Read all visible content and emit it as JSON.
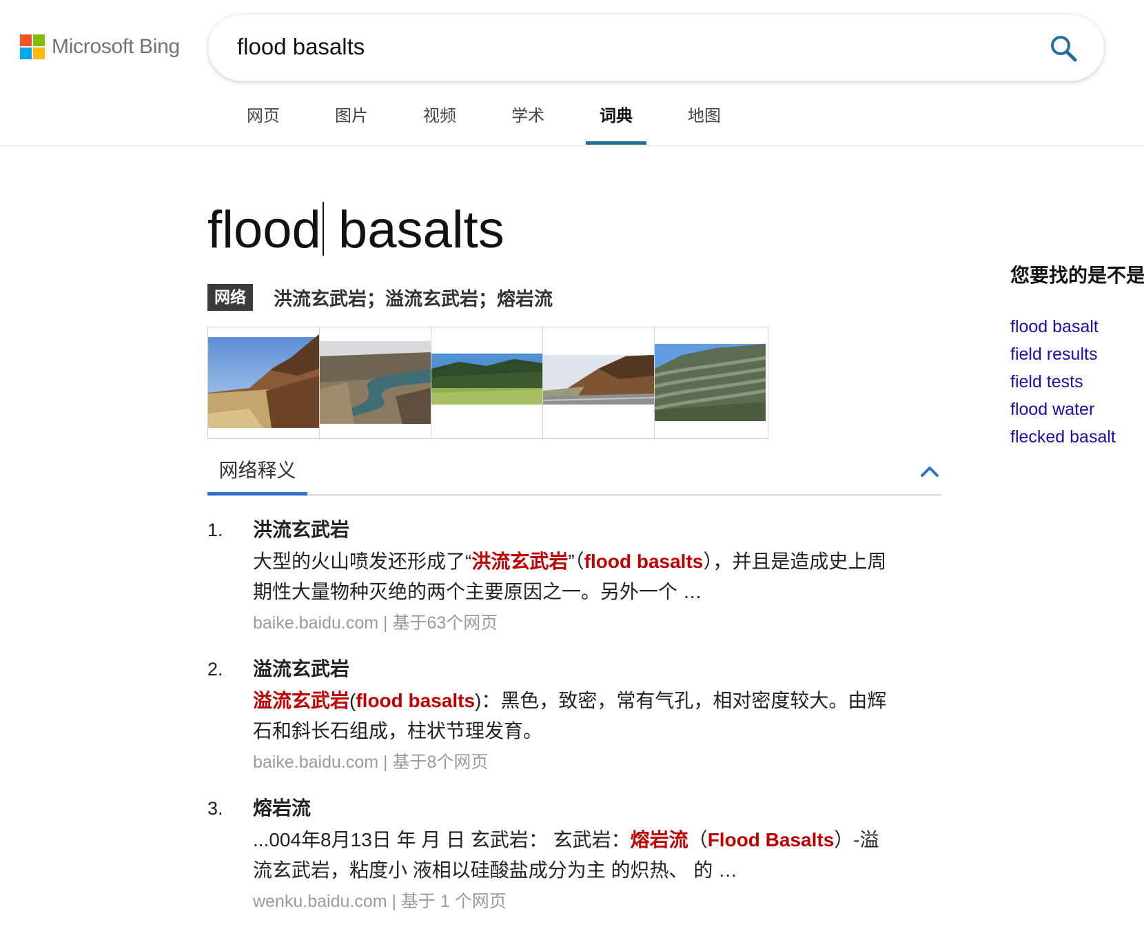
{
  "brand": {
    "name": "Microsoft Bing",
    "logo_colors": [
      "#f35325",
      "#81bc06",
      "#05a6f0",
      "#ffba08"
    ]
  },
  "search": {
    "query": "flood basalts",
    "button_icon": "search-icon"
  },
  "nav": {
    "tabs": [
      {
        "label": "网页"
      },
      {
        "label": "图片"
      },
      {
        "label": "视频"
      },
      {
        "label": "学术"
      },
      {
        "label": "词典",
        "active": true
      },
      {
        "label": "地图"
      }
    ],
    "accent_color": "#1f7399"
  },
  "dictionary": {
    "word": "flood basalts",
    "net_badge": "网络",
    "net_definitions": "洪流玄武岩；溢流玄武岩；熔岩流",
    "images": [
      {
        "name": "image-cliff-desert"
      },
      {
        "name": "image-river-canyon"
      },
      {
        "name": "image-forested-valley"
      },
      {
        "name": "image-roadside-outcrop"
      },
      {
        "name": "image-layered-hills"
      }
    ],
    "section_tab": "网络释义",
    "collapse_icon": "chevron-up-icon",
    "highlight_color": "#c00000",
    "entries": [
      {
        "num": "1.",
        "heading": "洪流玄武岩",
        "body": [
          {
            "t": "大型的火山喷发还形成了“"
          },
          {
            "t": "洪流玄武岩",
            "hl": true
          },
          {
            "t": "”（"
          },
          {
            "t": "flood basalts",
            "hl": true
          },
          {
            "t": "），并且是造成史上周期性大量物种灭绝的两个主要原因之一。另外一个 …"
          }
        ],
        "source": "baike.baidu.com | 基于63个网页"
      },
      {
        "num": "2.",
        "heading": "溢流玄武岩",
        "body": [
          {
            "t": "溢流玄武岩",
            "hl": true
          },
          {
            "t": "("
          },
          {
            "t": "flood basalts",
            "hl": true
          },
          {
            "t": ")：黑色，致密，常有气孔，相对密度较大。由辉石和斜长石组成，柱状节理发育。"
          }
        ],
        "source": "baike.baidu.com | 基于8个网页"
      },
      {
        "num": "3.",
        "heading": "熔岩流",
        "body": [
          {
            "t": "...004年8月13日 年 月 日 玄武岩： 玄武岩："
          },
          {
            "t": "熔岩流",
            "hl": true
          },
          {
            "t": "（"
          },
          {
            "t": "Flood Basalts",
            "hl": true
          },
          {
            "t": "）-溢流玄武岩，粘度小 液相以硅酸盐成分为主 的炽热、 的 …"
          }
        ],
        "source": "wenku.baidu.com | 基于 1 个网页"
      }
    ]
  },
  "did_you_mean": {
    "title": "您要找的是不是",
    "items": [
      "flood basalt",
      "field results",
      "field tests",
      "flood water",
      "flecked basalt"
    ],
    "link_color": "#1a0dab"
  }
}
